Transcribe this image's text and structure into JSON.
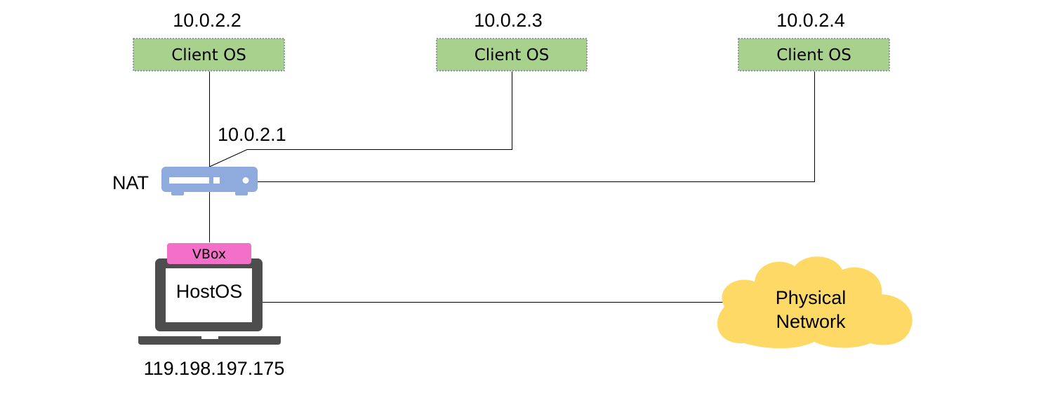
{
  "clients": [
    {
      "ip": "10.0.2.2",
      "label": "Client OS"
    },
    {
      "ip": "10.0.2.3",
      "label": "Client OS"
    },
    {
      "ip": "10.0.2.4",
      "label": "Client OS"
    }
  ],
  "nat": {
    "label": "NAT",
    "gateway_ip": "10.0.2.1"
  },
  "host": {
    "vbox_label": "VBox",
    "os_label": "HostOS",
    "ip": "119.198.197.175"
  },
  "cloud": {
    "line1": "Physical",
    "line2": "Network"
  },
  "colors": {
    "client_box": "#a9d18e",
    "nat_device": "#8faadc",
    "vbox": "#f270c8",
    "laptop": "#4d4d4d",
    "cloud": "#ffd966"
  }
}
